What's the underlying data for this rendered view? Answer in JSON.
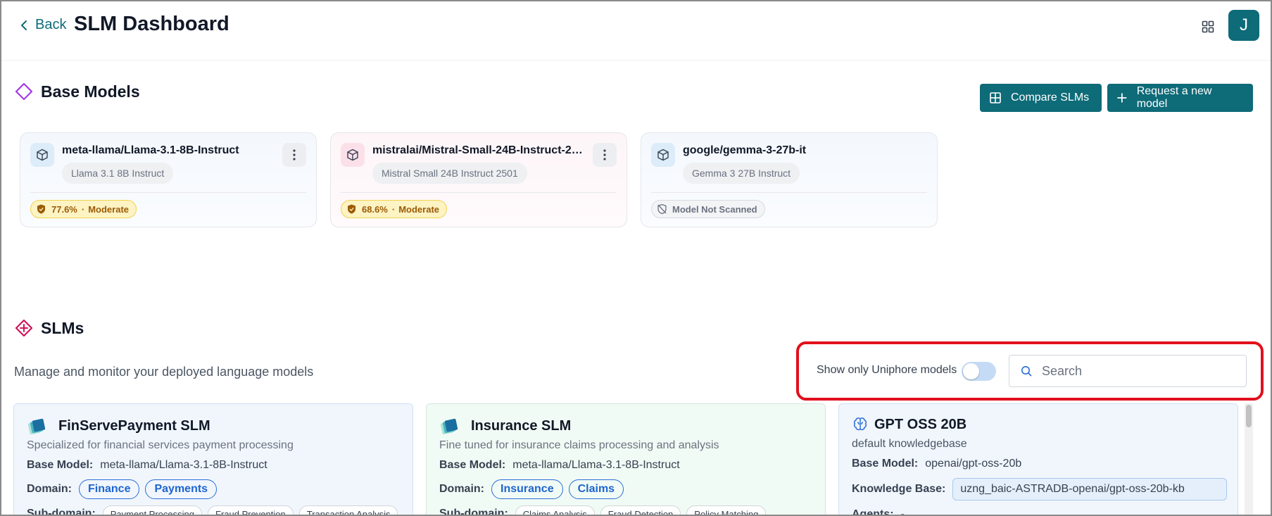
{
  "header": {
    "back_label": "Back",
    "title": "SLM Dashboard",
    "avatar_initial": "J"
  },
  "base_models": {
    "title": "Base Models",
    "compare_label": "Compare SLMs",
    "request_label": "Request a new model",
    "cards": [
      {
        "name": "meta-llama/Llama-3.1-8B-Instruct",
        "sub": "Llama 3.1 8B Instruct",
        "score": "77.6%",
        "risk": "Moderate",
        "color": "blue",
        "has_menu": true
      },
      {
        "name": "mistralai/Mistral-Small-24B-Instruct-2…",
        "sub": "Mistral Small 24B Instruct 2501",
        "score": "68.6%",
        "risk": "Moderate",
        "color": "pink",
        "has_menu": true
      },
      {
        "name": "google/gemma-3-27b-it",
        "sub": "Gemma 3 27B Instruct",
        "status": "Model Not Scanned",
        "color": "blue",
        "has_menu": false
      }
    ]
  },
  "slms": {
    "title": "SLMs",
    "subtitle": "Manage and monitor your deployed language models",
    "filter_label": "Show only Uniphore models",
    "toggle_on": false,
    "search_placeholder": "Search",
    "cards": [
      {
        "name": "FinServePayment SLM",
        "desc": "Specialized for financial services payment processing",
        "base_model_label": "Base Model:",
        "base_model": "meta-llama/Llama-3.1-8B-Instruct",
        "domain_label": "Domain:",
        "domains": [
          "Finance",
          "Payments"
        ],
        "subdomain_label": "Sub-domain:",
        "subdomains": [
          "Payment Processing",
          "Fraud Prevention",
          "Transaction Analysis"
        ]
      },
      {
        "name": "Insurance SLM",
        "desc": "Fine tuned for insurance claims processing and analysis",
        "base_model_label": "Base Model:",
        "base_model": "meta-llama/Llama-3.1-8B-Instruct",
        "domain_label": "Domain:",
        "domains": [
          "Insurance",
          "Claims"
        ],
        "subdomain_label": "Sub-domain:",
        "subdomains": [
          "Claims Analysis",
          "Fraud Detection",
          "Policy Matching"
        ]
      },
      {
        "name": "GPT OSS 20B",
        "desc": "default knowledgebase",
        "base_model_label": "Base Model:",
        "base_model": "openai/gpt-oss-20b",
        "kb_label": "Knowledge Base:",
        "kb": "uzng_baic-ASTRADB-openai/gpt-oss-20b-kb",
        "agents_label": "Agents:",
        "agents": "-"
      }
    ]
  },
  "colors": {
    "accent": "#0e6b78",
    "highlight": "#e1101c",
    "pill_blue": "#1d65d0",
    "base_models_icon": "#a23ce6",
    "slms_icon": "#d0145a"
  }
}
